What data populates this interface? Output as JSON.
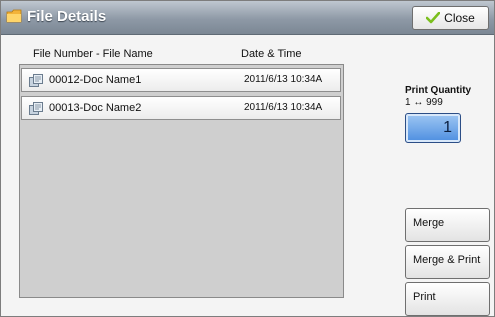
{
  "window": {
    "title": "File Details",
    "close_label": "Close"
  },
  "list": {
    "columns": {
      "file": "File Number - File Name",
      "datetime": "Date & Time"
    },
    "rows": [
      {
        "name": "00012-Doc Name1",
        "datetime": "2011/6/13 10:34A"
      },
      {
        "name": "00013-Doc Name2",
        "datetime": "2011/6/13 10:34A"
      }
    ]
  },
  "print_quantity": {
    "label": "Print Quantity",
    "range": "1 ↔ 999",
    "value": "1"
  },
  "actions": {
    "merge": "Merge",
    "merge_print": "Merge & Print",
    "print": "Print"
  },
  "colors": {
    "titlebar": "#8e99a6",
    "quantity_box": "#4d8ee0",
    "list_background": "#cfcfcf"
  },
  "icons": {
    "title": "folder-icon",
    "close": "check-icon",
    "row": "document-icon"
  }
}
